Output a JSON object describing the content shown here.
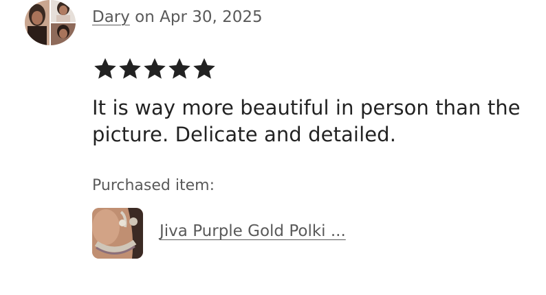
{
  "review": {
    "author": "Dary",
    "date_text": " on Apr 30, 2025",
    "rating": 5,
    "rating_max": 5,
    "text": "It is way more beautiful in person than the picture. Delicate and detailed."
  },
  "purchase": {
    "label": "Purchased item:",
    "item_name": "Jiva Purple Gold Polki ..."
  },
  "colors": {
    "text_primary": "#222222",
    "text_secondary": "#595959",
    "star": "#222222"
  }
}
